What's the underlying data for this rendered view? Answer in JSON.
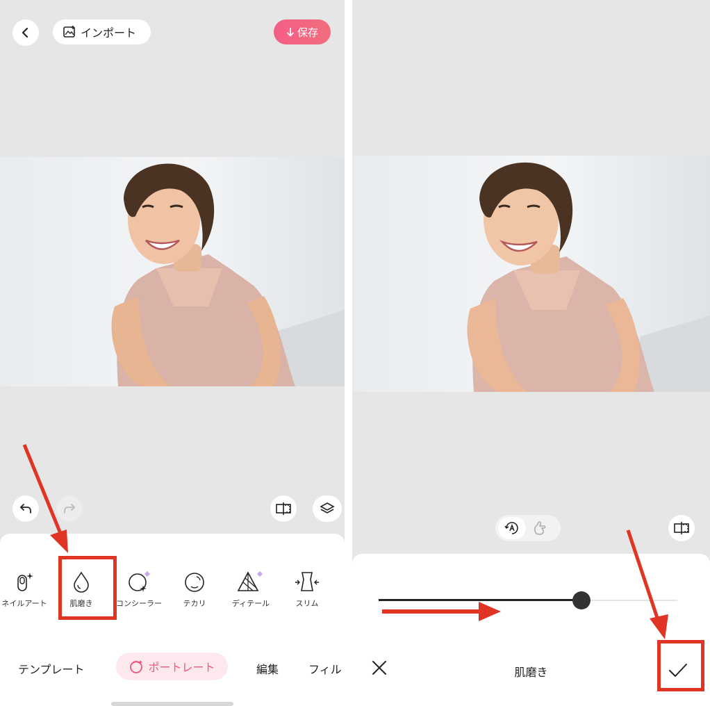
{
  "left": {
    "header": {
      "import_label": "インポート",
      "save_label": "保存"
    },
    "tools": [
      {
        "label": "ネイルアート",
        "icon": "nail-icon"
      },
      {
        "label": "肌磨き",
        "icon": "drop-icon"
      },
      {
        "label": "コンシーラー",
        "icon": "concealer-icon"
      },
      {
        "label": "テカリ",
        "icon": "face-shine-icon"
      },
      {
        "label": "ディテール",
        "icon": "detail-icon"
      },
      {
        "label": "スリム",
        "icon": "slim-icon"
      }
    ],
    "tabs": [
      {
        "label": "テンプレート"
      },
      {
        "label": "ポートレート",
        "active": true
      },
      {
        "label": "編集"
      },
      {
        "label": "フィル"
      }
    ]
  },
  "right": {
    "tool_title": "肌磨き",
    "slider": {
      "value_fraction": 0.68
    }
  },
  "colors": {
    "accent": "#f2557f",
    "annotation": "#e03424",
    "canvas_bg": "#e6e6e6"
  }
}
